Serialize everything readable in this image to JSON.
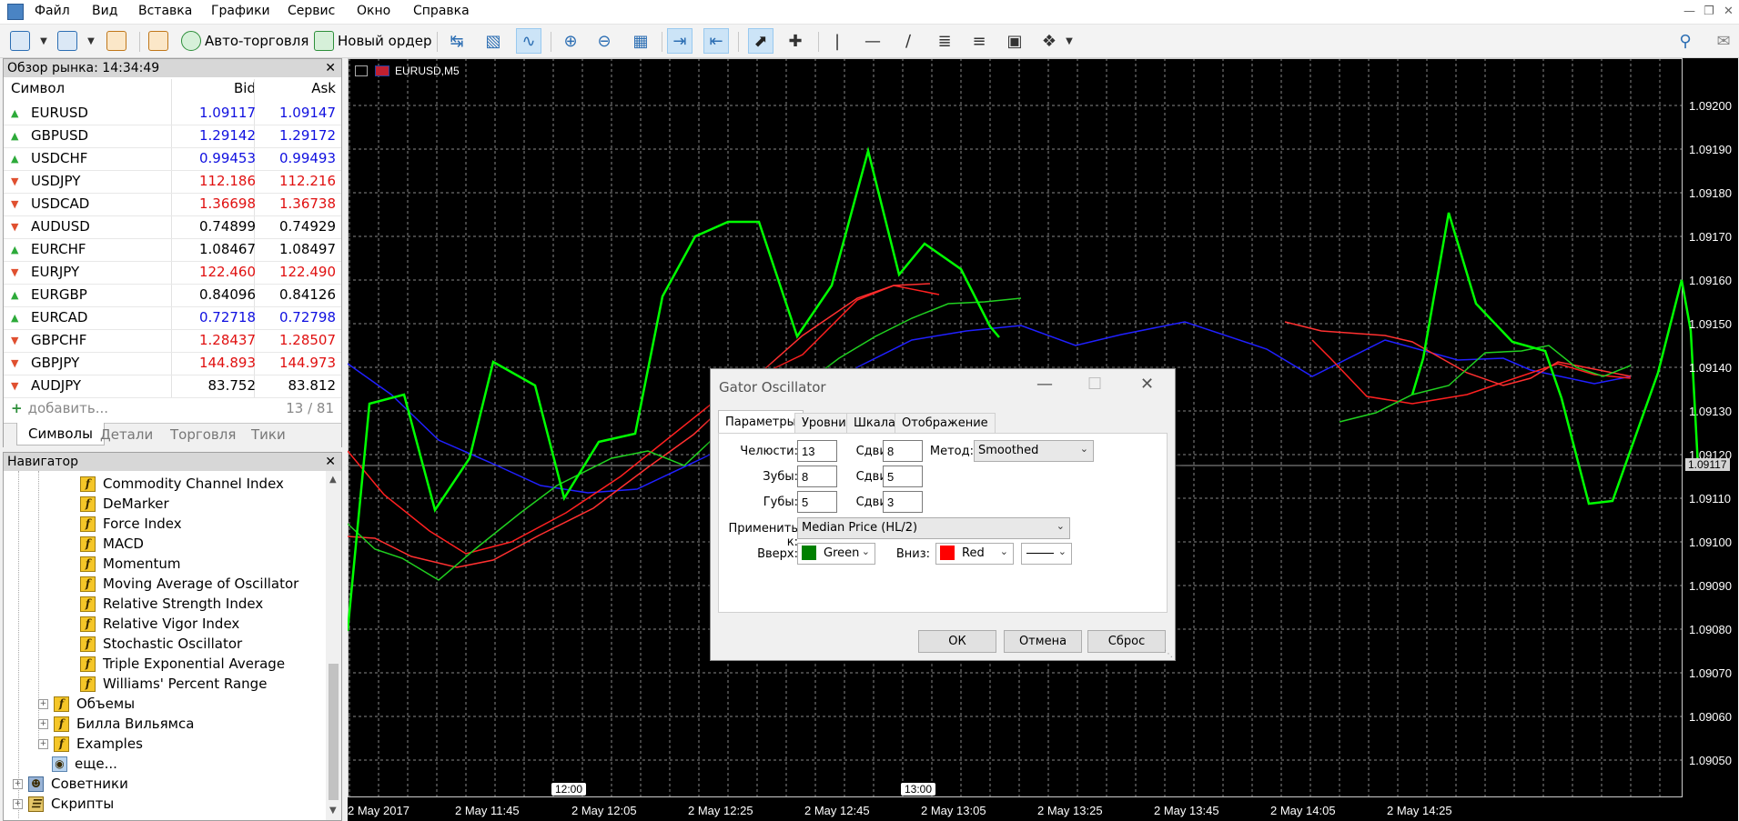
{
  "menu": {
    "items": [
      "Файл",
      "Вид",
      "Вставка",
      "Графики",
      "Сервис",
      "Окно",
      "Справка"
    ]
  },
  "toolbar": {
    "auto_trading": "Авто-торговля",
    "new_order": "Новый ордер"
  },
  "market_watch": {
    "title": "Обзор рынка: 14:34:49",
    "col_symbol": "Символ",
    "col_bid": "Bid",
    "col_ask": "Ask",
    "rows": [
      {
        "symbol": "EURUSD",
        "bid": "1.09117",
        "ask": "1.09147",
        "dir": "up",
        "color": "#1010e0"
      },
      {
        "symbol": "GBPUSD",
        "bid": "1.29142",
        "ask": "1.29172",
        "dir": "up",
        "color": "#1010e0"
      },
      {
        "symbol": "USDCHF",
        "bid": "0.99453",
        "ask": "0.99493",
        "dir": "up",
        "color": "#1010e0"
      },
      {
        "symbol": "USDJPY",
        "bid": "112.186",
        "ask": "112.216",
        "dir": "down",
        "color": "#e01010"
      },
      {
        "symbol": "USDCAD",
        "bid": "1.36698",
        "ask": "1.36738",
        "dir": "down",
        "color": "#e01010"
      },
      {
        "symbol": "AUDUSD",
        "bid": "0.74899",
        "ask": "0.74929",
        "dir": "down",
        "color": "#000000"
      },
      {
        "symbol": "EURCHF",
        "bid": "1.08467",
        "ask": "1.08497",
        "dir": "up",
        "color": "#000000"
      },
      {
        "symbol": "EURJPY",
        "bid": "122.460",
        "ask": "122.490",
        "dir": "down",
        "color": "#e01010"
      },
      {
        "symbol": "EURGBP",
        "bid": "0.84096",
        "ask": "0.84126",
        "dir": "up",
        "color": "#000000"
      },
      {
        "symbol": "EURCAD",
        "bid": "0.72718",
        "ask": "0.72798",
        "dir": "up",
        "color": "#1010e0"
      },
      {
        "symbol": "GBPCHF",
        "bid": "1.28437",
        "ask": "1.28507",
        "dir": "down",
        "color": "#e01010"
      },
      {
        "symbol": "GBPJPY",
        "bid": "144.893",
        "ask": "144.973",
        "dir": "down",
        "color": "#e01010"
      },
      {
        "symbol": "AUDJPY",
        "bid": "83.752",
        "ask": "83.812",
        "dir": "down",
        "color": "#000000"
      }
    ],
    "add": "добавить...",
    "count": "13 / 81",
    "tabs": [
      "Символы",
      "Детали",
      "Торговля",
      "Тики"
    ]
  },
  "navigator": {
    "title": "Навигатор",
    "indicators": [
      "Commodity Channel Index",
      "DeMarker",
      "Force Index",
      "MACD",
      "Momentum",
      "Moving Average of Oscillator",
      "Relative Strength Index",
      "Relative Vigor Index",
      "Stochastic Oscillator",
      "Triple Exponential Average",
      "Williams' Percent Range"
    ],
    "groups": [
      "Объемы",
      "Билла Вильямса",
      "Examples",
      "еще..."
    ],
    "roots": [
      "Советники",
      "Скрипты"
    ]
  },
  "chart": {
    "title": "EURUSD,M5",
    "price_marker": "1.09117",
    "y_ticks": [
      "1.09200",
      "1.09190",
      "1.09180",
      "1.09170",
      "1.09160",
      "1.09150",
      "1.09140",
      "1.09130",
      "1.09120",
      "1.09110",
      "1.09100",
      "1.09090",
      "1.09080",
      "1.09070",
      "1.09060",
      "1.09050"
    ],
    "x_ticks": [
      "2 May 2017",
      "2 May 11:45",
      "2 May 12:05",
      "2 May 12:25",
      "2 May 12:45",
      "2 May 13:05",
      "2 May 13:25",
      "2 May 13:45",
      "2 May 14:05",
      "2 May 14:25"
    ],
    "time_markers": [
      "12:00",
      "13:00"
    ]
  },
  "dialog": {
    "title": "Gator Oscillator",
    "tabs": [
      "Параметры",
      "Уровни",
      "Шкала",
      "Отображение"
    ],
    "jaws_label": "Челюсти:",
    "jaws_value": "13",
    "teeth_label": "Зубы:",
    "teeth_value": "8",
    "lips_label": "Губы:",
    "lips_value": "5",
    "shift_label": "Сдвиг:",
    "jaws_shift": "8",
    "teeth_shift": "5",
    "lips_shift": "3",
    "method_label": "Метод:",
    "method_value": "Smoothed",
    "apply_label": "Применить к:",
    "apply_value": "Median Price (HL/2)",
    "up_label": "Вверх:",
    "up_value": "Green",
    "up_color": "#008000",
    "down_label": "Вниз:",
    "down_value": "Red",
    "down_color": "#ff0000",
    "ok": "ОК",
    "cancel": "Отмена",
    "reset": "Сброс"
  }
}
